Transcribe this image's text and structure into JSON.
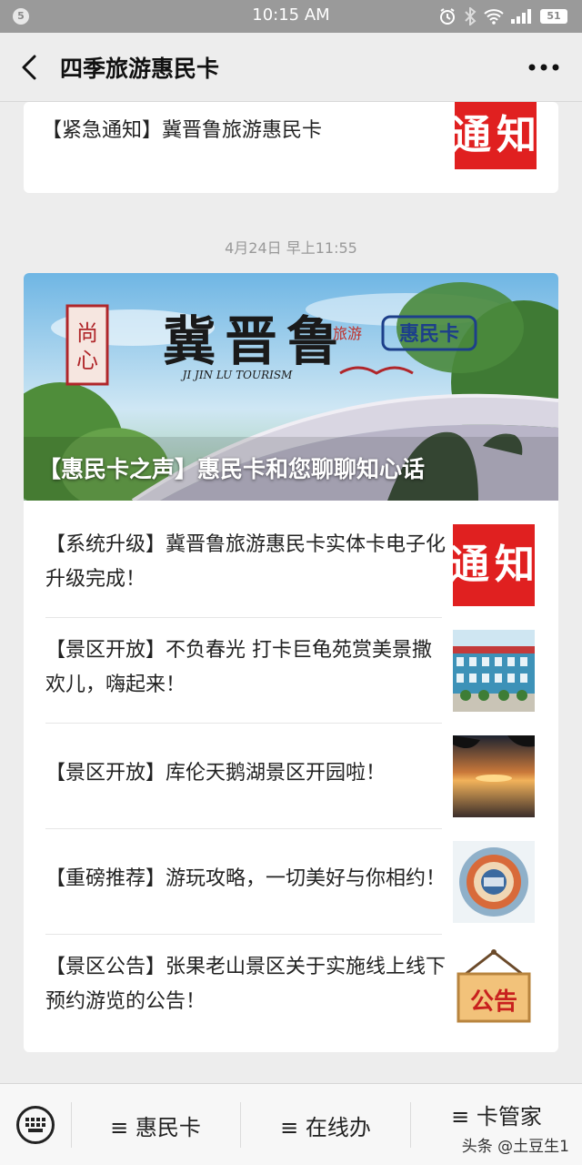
{
  "status_bar": {
    "notification_count": "5",
    "time": "10:15 AM",
    "battery": "51"
  },
  "nav": {
    "title": "四季旅游惠民卡",
    "back_icon": "back-arrow-icon",
    "more_icon": "more-dots-icon"
  },
  "message1": {
    "title": "【紧急通知】冀晋鲁旅游惠民卡",
    "thumb_text": "通知"
  },
  "timestamp": "4月24日 早上11:55",
  "message2": {
    "cover": {
      "title": "【惠民卡之声】惠民卡和您聊聊知心话",
      "brand": "冀晋鲁",
      "subtitle": "JI JIN LU TOURISM",
      "badge": "惠民卡",
      "tag": "旅游"
    },
    "items": [
      {
        "title": "【系统升级】冀晋鲁旅游惠民卡实体卡电子化升级完成！",
        "thumb": "notice",
        "thumb_text": "通知"
      },
      {
        "title": "【景区开放】不负春光 打卡巨龟苑赏美景撒欢儿，嗨起来！",
        "thumb": "building"
      },
      {
        "title": "【景区开放】库伦天鹅湖景区开园啦！",
        "thumb": "sunset"
      },
      {
        "title": "【重磅推荐】游玩攻略，一切美好与你相约！",
        "thumb": "diagram"
      },
      {
        "title": "【景区公告】张果老山景区关于实施线上线下预约游览的公告！",
        "thumb": "announcement",
        "thumb_text": "公告"
      }
    ]
  },
  "bottom_menu": {
    "keyboard_icon": "keyboard-icon",
    "items": [
      "≡ 惠民卡",
      "≡ 在线办",
      "≡ 卡管家"
    ]
  },
  "watermark": "头条 @土豆生1",
  "colors": {
    "notice_red": "#e02020",
    "background": "#ededed"
  }
}
